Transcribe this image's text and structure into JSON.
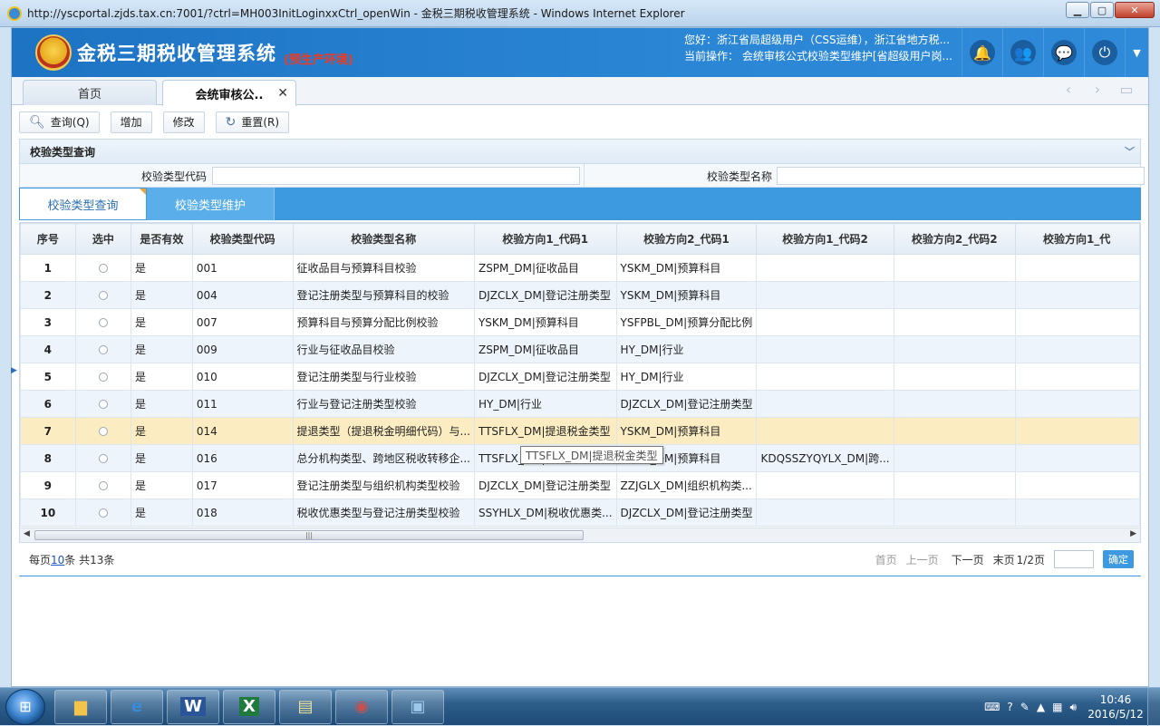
{
  "window": {
    "title": "http://yscportal.zjds.tax.cn:7001/?ctrl=MH003InitLoginxxCtrl_openWin - 金税三期税收管理系统 - Windows Internet Explorer"
  },
  "header": {
    "system_title": "金税三期税收管理系统",
    "env_label": "(预生产环境)",
    "greeting": "您好：浙江省局超级用户（CSS运维），浙江省地方税...",
    "current_op": "当前操作： 会统审核公式校验类型维护[省超级用户岗..."
  },
  "tabs": {
    "home": "首页",
    "active": "会统审核公.."
  },
  "toolbar": {
    "query": "查询(Q)",
    "add": "增加",
    "edit": "修改",
    "reset": "重置(R)"
  },
  "section": {
    "title": "校验类型查询"
  },
  "filter": {
    "code_label": "校验类型代码",
    "name_label": "校验类型名称"
  },
  "subtabs": {
    "query": "校验类型查询",
    "maintain": "校验类型维护"
  },
  "grid": {
    "headers": [
      "序号",
      "选中",
      "是否有效",
      "校验类型代码",
      "校验类型名称",
      "校验方向1_代码1",
      "校验方向2_代码1",
      "校验方向1_代码2",
      "校验方向2_代码2",
      "校验方向1_代"
    ],
    "rows": [
      [
        "1",
        "",
        "是",
        "001",
        "征收品目与预算科目校验",
        "ZSPM_DM|征收品目",
        "YSKM_DM|预算科目",
        "",
        "",
        ""
      ],
      [
        "2",
        "",
        "是",
        "004",
        "登记注册类型与预算科目的校验",
        "DJZCLX_DM|登记注册类型",
        "YSKM_DM|预算科目",
        "",
        "",
        ""
      ],
      [
        "3",
        "",
        "是",
        "007",
        "预算科目与预算分配比例校验",
        "YSKM_DM|预算科目",
        "YSFPBL_DM|预算分配比例",
        "",
        "",
        ""
      ],
      [
        "4",
        "",
        "是",
        "009",
        "行业与征收品目校验",
        "ZSPM_DM|征收品目",
        "HY_DM|行业",
        "",
        "",
        ""
      ],
      [
        "5",
        "",
        "是",
        "010",
        "登记注册类型与行业校验",
        "DJZCLX_DM|登记注册类型",
        "HY_DM|行业",
        "",
        "",
        ""
      ],
      [
        "6",
        "",
        "是",
        "011",
        "行业与登记注册类型校验",
        "HY_DM|行业",
        "DJZCLX_DM|登记注册类型",
        "",
        "",
        ""
      ],
      [
        "7",
        "",
        "是",
        "014",
        "提退类型（提退税金明细代码）与...",
        "TTSFLX_DM|提退税金类型",
        "YSKM_DM|预算科目",
        "",
        "",
        ""
      ],
      [
        "8",
        "",
        "是",
        "016",
        "总分机构类型、跨地区税收转移企...",
        "TTSFLX_DM|提退税金类型",
        "YSKM_DM|预算科目",
        "KDQSSZYQYLX_DM|跨...",
        "",
        ""
      ],
      [
        "9",
        "",
        "是",
        "017",
        "登记注册类型与组织机构类型校验",
        "DJZCLX_DM|登记注册类型",
        "ZZJGLX_DM|组织机构类...",
        "",
        "",
        ""
      ],
      [
        "10",
        "",
        "是",
        "018",
        "税收优惠类型与登记注册类型校验",
        "SSYHLX_DM|税收优惠类...",
        "DJZCLX_DM|登记注册类型",
        "",
        "",
        ""
      ]
    ],
    "tooltip": "TTSFLX_DM|提退税金类型"
  },
  "pager": {
    "per_page_prefix": "每页",
    "per_page": "10",
    "per_page_suffix": "条 共13条",
    "first": "首页",
    "prev": "上一页",
    "next": "下一页",
    "last": "末页",
    "page_info": "1/2页",
    "confirm": "确定"
  },
  "taskbar": {
    "time": "10:46",
    "date": "2016/5/12"
  },
  "colors": {
    "header_blue": "#2b86d6",
    "accent_blue": "#3d9ae0",
    "env_red": "#f23a1f",
    "selected_row": "#fbecc2"
  }
}
